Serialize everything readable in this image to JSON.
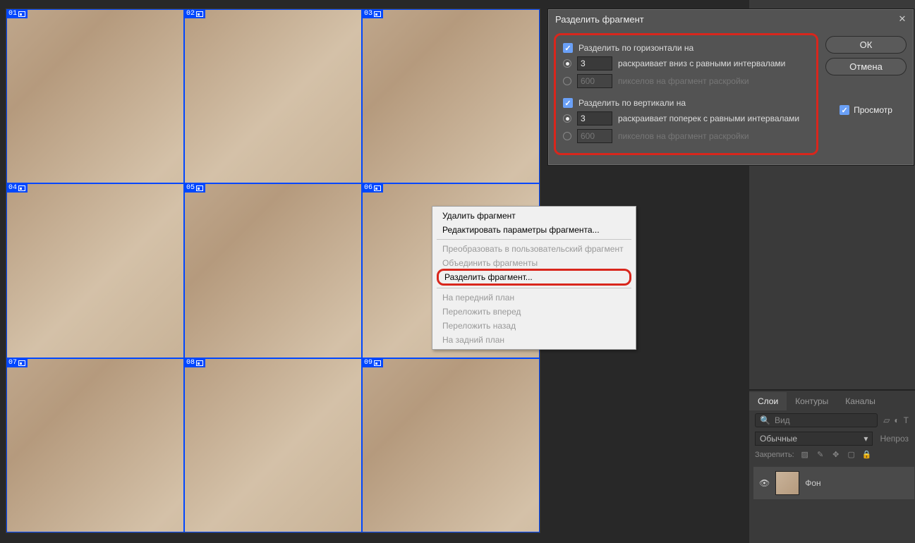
{
  "slices": [
    "01",
    "02",
    "03",
    "04",
    "05",
    "06",
    "07",
    "08",
    "09"
  ],
  "context_menu": {
    "delete": "Удалить фрагмент",
    "edit": "Редактировать параметры фрагмента...",
    "convert": "Преобразовать в пользовательский фрагмент",
    "combine": "Объединить фрагменты",
    "divide": "Разделить фрагмент...",
    "front": "На передний план",
    "forward": "Переложить вперед",
    "backward": "Переложить назад",
    "back": "На задний план"
  },
  "dialog": {
    "title": "Разделить фрагмент",
    "horiz_label": "Разделить по горизонтали на",
    "horiz_count": "3",
    "horiz_count_hint": "раскраивает вниз с равными интервалами",
    "horiz_px": "600",
    "horiz_px_hint": "пикселов на фрагмент раскройки",
    "vert_label": "Разделить по вертикали на",
    "vert_count": "3",
    "vert_count_hint": "раскраивает поперек с равными интервалами",
    "vert_px": "600",
    "vert_px_hint": "пикселов на фрагмент раскройки",
    "ok": "ОК",
    "cancel": "Отмена",
    "preview": "Просмотр"
  },
  "panels": {
    "tabs": {
      "layers": "Слои",
      "paths": "Контуры",
      "channels": "Каналы"
    },
    "search_placeholder": "Вид",
    "mode": "Обычные",
    "opacity_label": "Непроз",
    "lock_label": "Закрепить:",
    "layer_name": "Фон"
  }
}
